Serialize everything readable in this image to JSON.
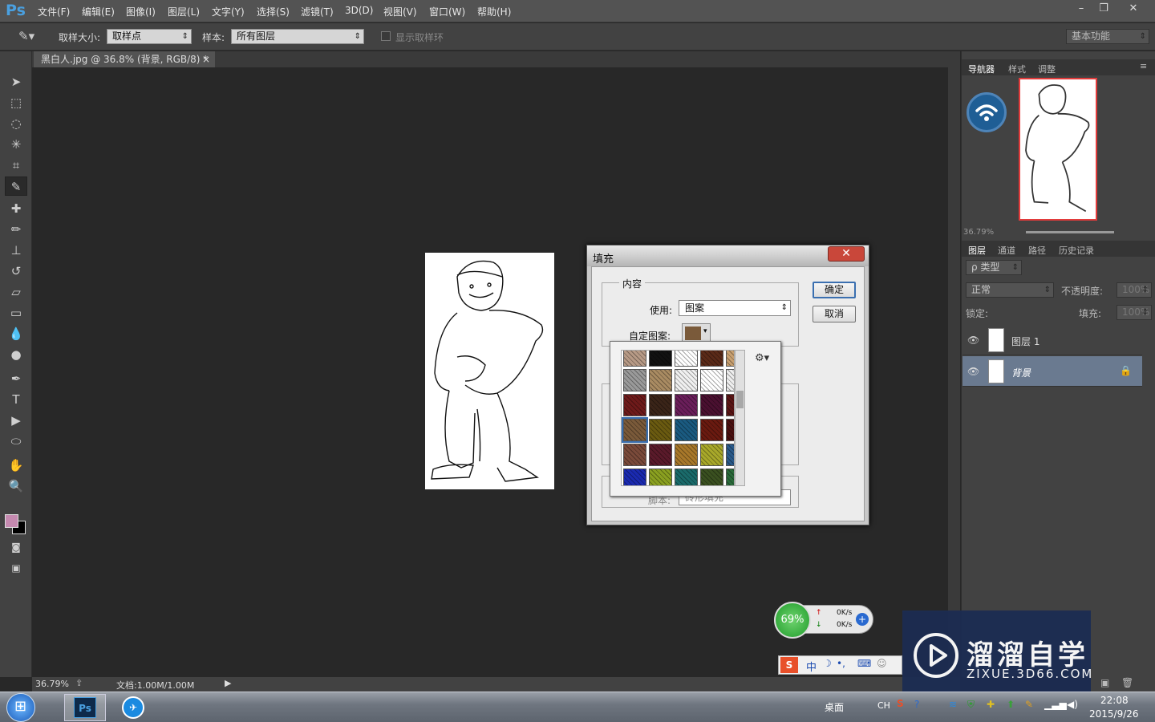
{
  "app": {
    "logo": "Ps"
  },
  "menu": [
    "文件(F)",
    "编辑(E)",
    "图像(I)",
    "图层(L)",
    "文字(Y)",
    "选择(S)",
    "滤镜(T)",
    "3D(D)",
    "视图(V)",
    "窗口(W)",
    "帮助(H)"
  ],
  "window_controls": {
    "minimize": "–",
    "restore": "❐",
    "close": "✕"
  },
  "options": {
    "sample_size_label": "取样大小:",
    "sample_size_value": "取样点",
    "sample_label": "样本:",
    "sample_value": "所有图层",
    "show_ring_label": "显示取样环",
    "workspace": "基本功能"
  },
  "document_tab": {
    "title": "黑白人.jpg @ 36.8% (背景, RGB/8) *",
    "close": "×"
  },
  "status": {
    "zoom": "36.79%",
    "doc_info": "文档:1.00M/1.00M"
  },
  "panels": {
    "top_tabs": [
      "导航器",
      "样式",
      "调整"
    ],
    "nav_zoom": "36.79%",
    "layer_tabs": [
      "图层",
      "通道",
      "路径",
      "历史记录"
    ],
    "filter_kind": "ρ 类型",
    "blend_mode": "正常",
    "opacity_label": "不透明度:",
    "opacity_value": "100%",
    "lock_label": "锁定:",
    "fill_label": "填充:",
    "fill_value": "100%",
    "layers": [
      {
        "name": "图层 1",
        "selected": false,
        "locked": false
      },
      {
        "name": "背景",
        "selected": true,
        "locked": true
      }
    ]
  },
  "dialog": {
    "title": "填充",
    "group_content": "内容",
    "use_label": "使用:",
    "use_value": "图案",
    "custom_pattern_label": "自定图案:",
    "ok": "确定",
    "cancel": "取消",
    "hidden_row_label": "脚本:",
    "hidden_row_value": "砖形填充"
  },
  "pattern_colors": [
    [
      "#b79a86",
      "#111111",
      "#ffffff",
      "#5a2a18",
      "#c8a070"
    ],
    [
      "#9a9a9a",
      "#a98b62",
      "#f0f0f0",
      "#ffffff",
      "#eeeeee"
    ],
    [
      "#6e1a1a",
      "#3a2418",
      "#6a1e5a",
      "#4a1030",
      "#5a1515"
    ],
    [
      "#7a5a3a",
      "#6a5a10",
      "#1a5a80",
      "#6a1a10",
      "#4a1010"
    ],
    [
      "#7a4a3a",
      "#5a1a2a",
      "#a8782a",
      "#a8a82a",
      "#2a5a8a"
    ],
    [
      "#1a2ab0",
      "#8aa020",
      "#1a6a6a",
      "#3a5020",
      "#2a6a3a"
    ]
  ],
  "network": {
    "percent": "69%",
    "up": "0K/s",
    "down": "0K/s"
  },
  "ime": {
    "label": "中"
  },
  "watermark": {
    "title": "溜溜自学",
    "url": "ZIXUE.3D66.COM"
  },
  "taskbar": {
    "desktop": "桌面",
    "lang": "CH",
    "time": "22:08",
    "date": "2015/9/26"
  }
}
